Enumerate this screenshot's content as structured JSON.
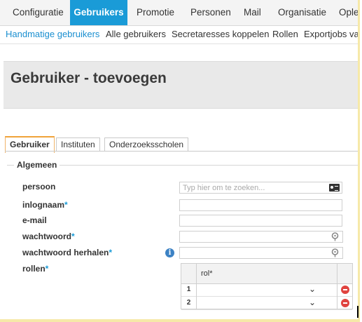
{
  "topnav": {
    "items": [
      {
        "label": "Configuratie",
        "active": false
      },
      {
        "label": "Gebruikers",
        "active": true
      },
      {
        "label": "Promotie",
        "active": false
      },
      {
        "label": "Personen",
        "active": false
      },
      {
        "label": "Mail",
        "active": false
      },
      {
        "label": "Organisatie",
        "active": false
      },
      {
        "label": "Ople",
        "active": false
      }
    ]
  },
  "subnav": {
    "items": [
      {
        "label": "Handmatige gebruikers",
        "active": true
      },
      {
        "label": "Alle gebruikers",
        "active": false
      },
      {
        "label": "Secretaresses koppelen",
        "active": false
      },
      {
        "label": "Rollen",
        "active": false
      },
      {
        "label": "Exportjobs va",
        "active": false
      }
    ]
  },
  "page": {
    "title": "Gebruiker - toevoegen"
  },
  "tabs": [
    {
      "label": "Gebruiker",
      "active": true
    },
    {
      "label": "Instituten",
      "active": false
    },
    {
      "label": "Onderzoeksscholen",
      "active": false
    }
  ],
  "form": {
    "legend": "Algemeen",
    "required_mark": "*",
    "fields": {
      "persoon": {
        "label": "persoon",
        "placeholder": "Typ hier om te zoeken...",
        "value": ""
      },
      "inlognaam": {
        "label": "inlognaam",
        "value": ""
      },
      "email": {
        "label": "e-mail",
        "value": ""
      },
      "wachtwoord": {
        "label": "wachtwoord",
        "value": ""
      },
      "wachtwoord_herhalen": {
        "label": "wachtwoord herhalen",
        "value": ""
      },
      "rollen": {
        "label": "rollen"
      }
    },
    "rollen_grid": {
      "column": "rol*",
      "rows": [
        {
          "num": "1",
          "value": ""
        },
        {
          "num": "2",
          "value": ""
        }
      ]
    }
  },
  "icons": {
    "person_search": "id-card-icon",
    "password_reveal": "key-icon",
    "info": "info-icon",
    "delete": "delete-row-icon"
  },
  "colors": {
    "accent": "#1a9bd7",
    "tab_active_border": "#f0a33a",
    "delete": "#e0433f"
  }
}
